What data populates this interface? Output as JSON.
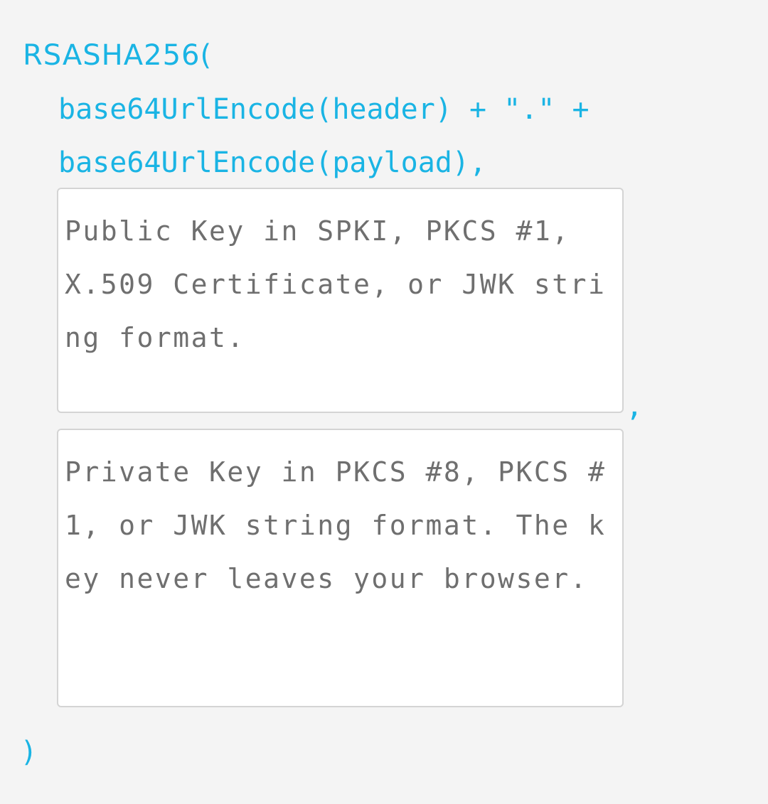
{
  "signature": {
    "function_open": "RSASHA256(",
    "header_line": "base64UrlEncode(header) + \".\" +",
    "payload_line": "base64UrlEncode(payload),",
    "separator": ",",
    "function_close": ")"
  },
  "public_key": {
    "placeholder": "Public Key in SPKI, PKCS #1, X.509 Certificate, or JWK string format.",
    "value": ""
  },
  "private_key": {
    "placeholder": "Private Key in PKCS #8, PKCS #1, or JWK string format. The key never leaves your browser.",
    "value": ""
  },
  "colors": {
    "code_accent": "#1ab4e4",
    "placeholder_text": "#6f6f6f",
    "background": "#f4f4f4",
    "input_border": "#d4d4d4"
  }
}
